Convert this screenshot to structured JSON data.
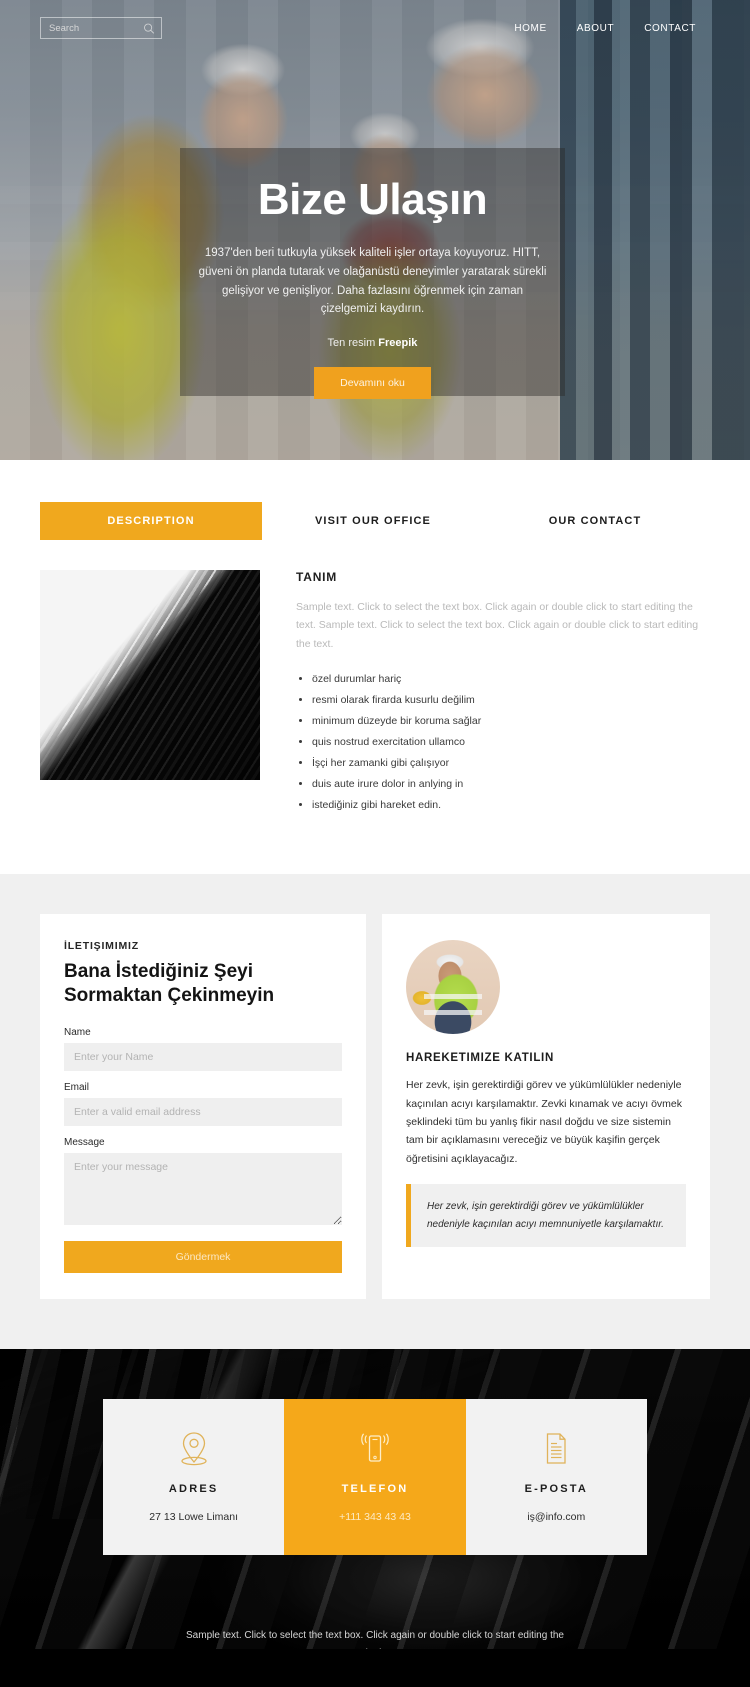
{
  "topbar": {
    "search_placeholder": "Search",
    "search_value": "",
    "nav": [
      {
        "label": "HOME"
      },
      {
        "label": "ABOUT"
      },
      {
        "label": "CONTACT"
      }
    ]
  },
  "hero": {
    "title": "Bize Ulaşın",
    "paragraph": "1937'den beri tutkuyla yüksek kaliteli işler ortaya koyuyoruz. HITT, güveni ön planda tutarak ve olağanüstü deneyimler yaratarak sürekli gelişiyor ve genişliyor. Daha fazlasını öğrenmek için zaman çizelgemizi kaydırın.",
    "credit_prefix": "Ten resim",
    "credit_source": "Freepik",
    "button_label": "Devamını oku"
  },
  "tabs": {
    "items": [
      {
        "label": "DESCRIPTION",
        "active": true
      },
      {
        "label": "VISIT OUR OFFICE",
        "active": false
      },
      {
        "label": "OUR CONTACT",
        "active": false
      }
    ]
  },
  "description": {
    "title": "TANIM",
    "paragraph": "Sample text. Click to select the text box. Click again or double click to start editing the text. Sample text. Click to select the text box. Click again or double click to start editing the text.",
    "bullets": [
      "özel durumlar hariç",
      "resmi olarak firarda kusurlu değilim",
      "minimum düzeyde bir koruma sağlar",
      "quis nostrud exercitation ullamco",
      "İşçi her zamanki gibi çalışıyor",
      "duis aute irure dolor in anlying in",
      "istediğiniz gibi hareket edin."
    ]
  },
  "contact_form": {
    "eyebrow": "İLETIŞIMIMIZ",
    "heading": "Bana İstediğiniz Şeyi Sormaktan Çekinmeyin",
    "fields": [
      {
        "label": "Name",
        "placeholder": "Enter your Name",
        "value": ""
      },
      {
        "label": "Email",
        "placeholder": "Enter a valid email address",
        "value": ""
      },
      {
        "label": "Message",
        "placeholder": "Enter your message",
        "value": ""
      }
    ],
    "submit_label": "Göndermek"
  },
  "join": {
    "title": "HAREKETIMIZE KATILIN",
    "paragraph": "Her zevk, işin gerektirdiği görev ve yükümlülükler nedeniyle kaçınılan acıyı karşılamaktır.\nZevki kınamak ve acıyı övmek şeklindeki tüm bu yanlış fikir nasıl doğdu ve size sistemin tam bir açıklamasını vereceğiz ve büyük kaşifin gerçek öğretisini açıklayacağız.",
    "quote": "Her zevk, işin gerektirdiği görev ve yükümlülükler nedeniyle kaçınılan acıyı memnuniyetle karşılamaktır."
  },
  "info_cards": [
    {
      "icon": "map-pin-icon",
      "title": "ADRES",
      "value": "27 13 Lowe Limanı",
      "highlight": false
    },
    {
      "icon": "mobile-phone-icon",
      "title": "TELEFON",
      "value": "+111 343 43 43",
      "highlight": true
    },
    {
      "icon": "document-icon",
      "title": "E-POSTA",
      "value": "iş@info.com",
      "highlight": false
    }
  ],
  "footer": {
    "note": "Sample text. Click to select the text box. Click again or double click to start editing the text."
  },
  "colors": {
    "accent": "#f0a81e",
    "accent_bright": "#f5a81a",
    "dark": "#000000",
    "field_bg": "#efefef",
    "section_bg": "#f0f0f0"
  }
}
